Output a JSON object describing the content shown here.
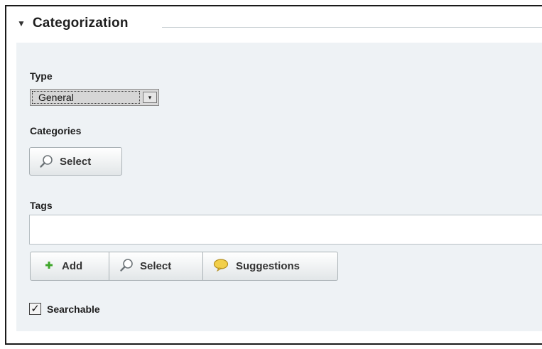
{
  "section": {
    "title": "Categorization",
    "collapse_icon": "triangle-down-icon"
  },
  "type_field": {
    "label": "Type",
    "selected": "General",
    "arrow": "▾"
  },
  "categories": {
    "label": "Categories",
    "select_label": "Select",
    "icon": "magnifier-icon"
  },
  "tags": {
    "label": "Tags",
    "input_value": "",
    "buttons": [
      {
        "label": "Add",
        "icon": "plus-icon"
      },
      {
        "label": "Select",
        "icon": "magnifier-icon"
      },
      {
        "label": "Suggestions",
        "icon": "speech-bubble-icon"
      }
    ]
  },
  "searchable": {
    "label": "Searchable",
    "checked": true,
    "mark": "✓"
  },
  "colors": {
    "panel_bg": "#eef2f5",
    "plus_green": "#3fa62a",
    "bubble_yellow": "#f2cf4a"
  }
}
